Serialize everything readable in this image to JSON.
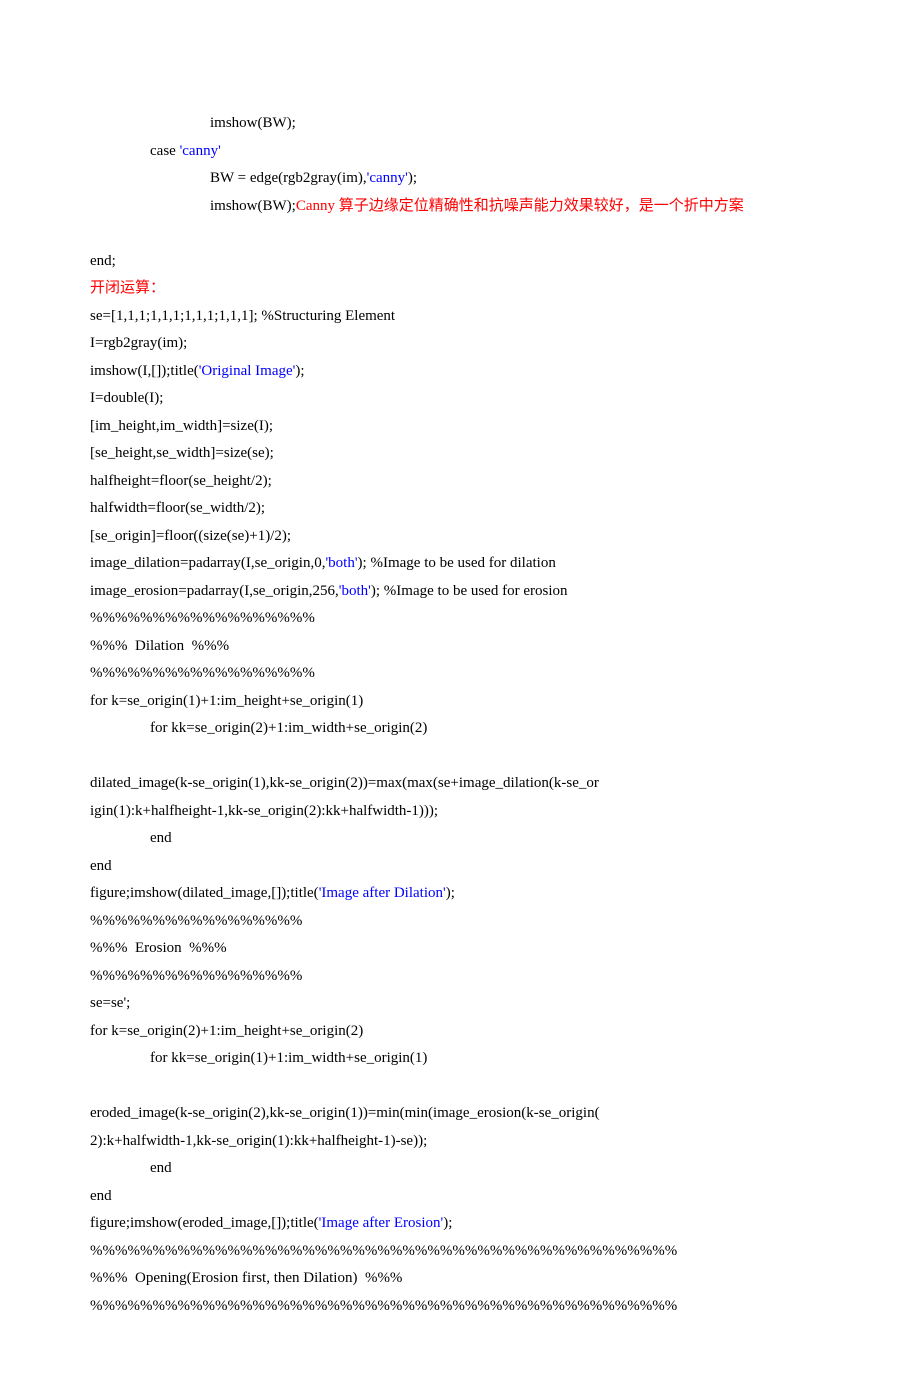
{
  "lines": [
    {
      "cls": "i2",
      "spans": [
        {
          "t": "imshow(BW);"
        }
      ]
    },
    {
      "cls": "i1",
      "spans": [
        {
          "t": "case "
        },
        {
          "t": "'canny'",
          "c": "blue"
        }
      ]
    },
    {
      "cls": "i2",
      "spans": [
        {
          "t": "BW = edge(rgb2gray(im),"
        },
        {
          "t": "'canny'",
          "c": "blue"
        },
        {
          "t": ");"
        }
      ]
    },
    {
      "cls": "i2",
      "spans": [
        {
          "t": "imshow(BW);"
        },
        {
          "t": "Canny 算子边缘定位精确性和抗噪声能力效果较好，是一个折中方案",
          "c": "red"
        }
      ]
    },
    {
      "cls": "",
      "spans": [
        {
          "t": " "
        }
      ]
    },
    {
      "cls": "",
      "spans": [
        {
          "t": "end;"
        }
      ]
    },
    {
      "cls": "",
      "spans": [
        {
          "t": "开闭运算：",
          "c": "red"
        }
      ]
    },
    {
      "cls": "",
      "spans": [
        {
          "t": "se=[1,1,1;1,1,1;1,1,1;1,1,1]; "
        },
        {
          "t": "%Structuring Element"
        }
      ]
    },
    {
      "cls": "",
      "spans": [
        {
          "t": "I=rgb2gray(im);"
        }
      ]
    },
    {
      "cls": "",
      "spans": [
        {
          "t": "imshow(I,[]);title("
        },
        {
          "t": "'Original Image'",
          "c": "blue"
        },
        {
          "t": ");"
        }
      ]
    },
    {
      "cls": "",
      "spans": [
        {
          "t": "I=double(I);"
        }
      ]
    },
    {
      "cls": "",
      "spans": [
        {
          "t": "[im_height,im_width]=size(I);"
        }
      ]
    },
    {
      "cls": "",
      "spans": [
        {
          "t": "[se_height,se_width]=size(se);"
        }
      ]
    },
    {
      "cls": "",
      "spans": [
        {
          "t": "halfheight=floor(se_height/2);"
        }
      ]
    },
    {
      "cls": "",
      "spans": [
        {
          "t": "halfwidth=floor(se_width/2);"
        }
      ]
    },
    {
      "cls": "",
      "spans": [
        {
          "t": "[se_origin]=floor((size(se)+1)/2);"
        }
      ]
    },
    {
      "cls": "",
      "spans": [
        {
          "t": "image_dilation=padarray(I,se_origin,0,"
        },
        {
          "t": "'both'",
          "c": "blue"
        },
        {
          "t": "); "
        },
        {
          "t": "%Image to be used for dilation"
        }
      ]
    },
    {
      "cls": "",
      "spans": [
        {
          "t": "image_erosion=padarray(I,se_origin,256,"
        },
        {
          "t": "'both'",
          "c": "blue"
        },
        {
          "t": "); "
        },
        {
          "t": "%Image to be used for erosion"
        }
      ]
    },
    {
      "cls": "",
      "spans": [
        {
          "t": "%%%%%%%%%%%%%%%%%%"
        }
      ]
    },
    {
      "cls": "",
      "spans": [
        {
          "t": "%%%  Dilation  %%%"
        }
      ]
    },
    {
      "cls": "",
      "spans": [
        {
          "t": "%%%%%%%%%%%%%%%%%%"
        }
      ]
    },
    {
      "cls": "",
      "spans": [
        {
          "t": "for k=se_origin(1)+1:im_height+se_origin(1)"
        }
      ]
    },
    {
      "cls": "i1",
      "spans": [
        {
          "t": "for kk=se_origin(2)+1:im_width+se_origin(2)"
        }
      ]
    },
    {
      "cls": "",
      "spans": [
        {
          "t": " "
        }
      ]
    },
    {
      "cls": "",
      "spans": [
        {
          "t": "dilated_image(k-se_origin(1),kk-se_origin(2))=max(max(se+image_dilation(k-se_or"
        }
      ]
    },
    {
      "cls": "",
      "spans": [
        {
          "t": "igin(1):k+halfheight-1,kk-se_origin(2):kk+halfwidth-1)));"
        }
      ]
    },
    {
      "cls": "i1",
      "spans": [
        {
          "t": "end"
        }
      ]
    },
    {
      "cls": "",
      "spans": [
        {
          "t": "end"
        }
      ]
    },
    {
      "cls": "",
      "spans": [
        {
          "t": "figure;imshow(dilated_image,[]);title("
        },
        {
          "t": "'Image after Dilation'",
          "c": "blue"
        },
        {
          "t": ");"
        }
      ]
    },
    {
      "cls": "",
      "spans": [
        {
          "t": "%%%%%%%%%%%%%%%%%"
        }
      ]
    },
    {
      "cls": "",
      "spans": [
        {
          "t": "%%%  Erosion  %%%"
        }
      ]
    },
    {
      "cls": "",
      "spans": [
        {
          "t": "%%%%%%%%%%%%%%%%%"
        }
      ]
    },
    {
      "cls": "",
      "spans": [
        {
          "t": "se=se';"
        }
      ]
    },
    {
      "cls": "",
      "spans": [
        {
          "t": "for k=se_origin(2)+1:im_height+se_origin(2)"
        }
      ]
    },
    {
      "cls": "i1",
      "spans": [
        {
          "t": "for kk=se_origin(1)+1:im_width+se_origin(1)"
        }
      ]
    },
    {
      "cls": "",
      "spans": [
        {
          "t": " "
        }
      ]
    },
    {
      "cls": "",
      "spans": [
        {
          "t": "eroded_image(k-se_origin(2),kk-se_origin(1))=min(min(image_erosion(k-se_origin("
        }
      ]
    },
    {
      "cls": "",
      "spans": [
        {
          "t": "2):k+halfwidth-1,kk-se_origin(1):kk+halfheight-1)-se));"
        }
      ]
    },
    {
      "cls": "i1",
      "spans": [
        {
          "t": "end"
        }
      ]
    },
    {
      "cls": "",
      "spans": [
        {
          "t": "end"
        }
      ]
    },
    {
      "cls": "",
      "spans": [
        {
          "t": "figure;imshow(eroded_image,[]);title("
        },
        {
          "t": "'Image after Erosion'",
          "c": "blue"
        },
        {
          "t": ");"
        }
      ]
    },
    {
      "cls": "",
      "spans": [
        {
          "t": "%%%%%%%%%%%%%%%%%%%%%%%%%%%%%%%%%%%%%%%%%%%%%%%"
        }
      ]
    },
    {
      "cls": "",
      "spans": [
        {
          "t": "%%%  Opening(Erosion first, then Dilation)  %%%"
        }
      ]
    },
    {
      "cls": "",
      "spans": [
        {
          "t": "%%%%%%%%%%%%%%%%%%%%%%%%%%%%%%%%%%%%%%%%%%%%%%%"
        }
      ]
    }
  ]
}
